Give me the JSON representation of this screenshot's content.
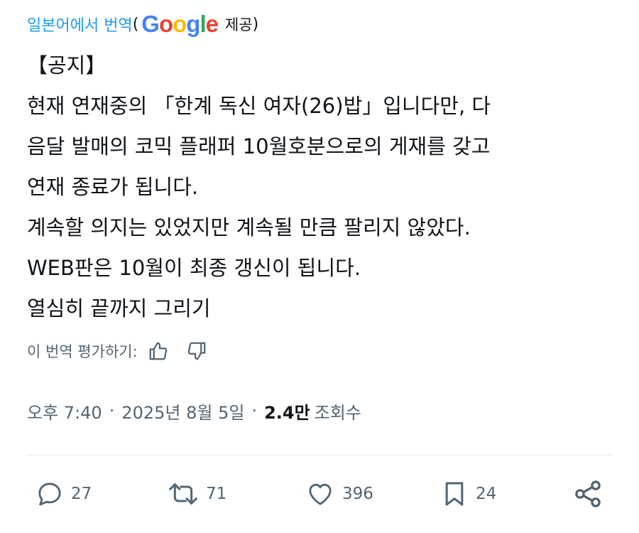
{
  "translation": {
    "link_text": "일본어에서 번역",
    "open_paren": "(",
    "google_logo": "Google",
    "provided_by": "제공",
    "close_paren": ")"
  },
  "tweet": {
    "lines": [
      "【공지】",
      "현재 연재중의 「한계 독신 여자(26)밥」입니다만, 다",
      "음달 발매의 코믹 플래퍼 10월호분으로의 게재를 갖고",
      "연재 종료가 됩니다.",
      "계속할 의지는 있었지만 계속될 만큼 팔리지 않았다.",
      "WEB판은 10월이 최종 갱신이 됩니다.",
      "열심히 끝까지 그리기"
    ]
  },
  "rating": {
    "label": "이 번역 평가하기:",
    "thumbs_up_icon": "thumbs-up-icon",
    "thumbs_down_icon": "thumbs-down-icon"
  },
  "meta": {
    "time": "오후 7:40",
    "separator": "·",
    "date": "2025년 8월 5일",
    "views_count": "2.4만",
    "views_label": "조회수"
  },
  "actions": {
    "replies": "27",
    "reposts": "71",
    "likes": "396",
    "bookmarks": "24"
  },
  "colors": {
    "link": "#1d9bf0",
    "text": "#0f1419",
    "secondary": "#536471",
    "divider": "#e6ecf0",
    "google_blue": "#4285F4",
    "google_red": "#EA4335",
    "google_yellow": "#FBBC05",
    "google_green": "#34A853"
  }
}
